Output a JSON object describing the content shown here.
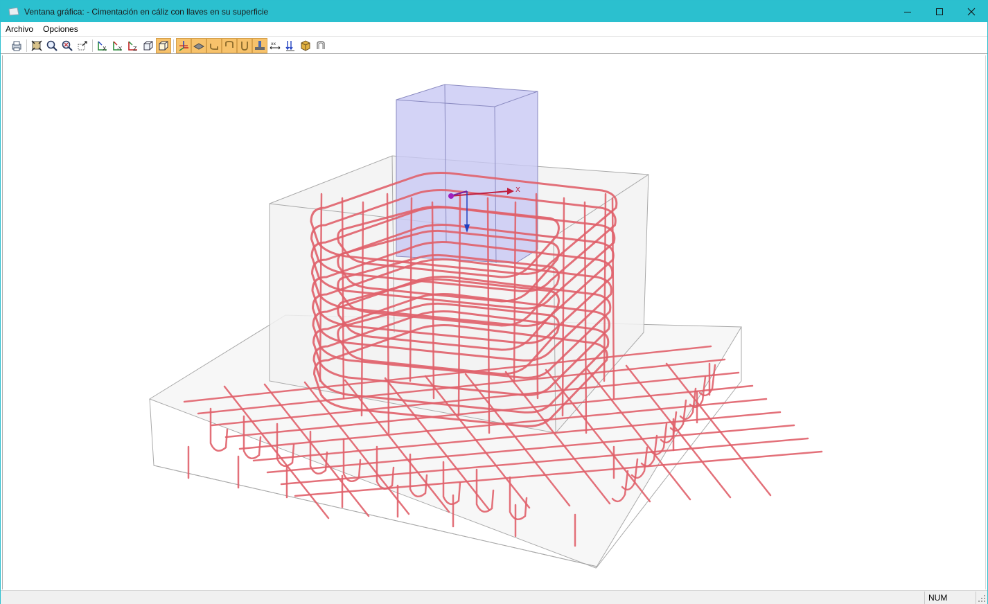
{
  "window": {
    "title": "Ventana gráfica: - Cimentación en cáliz con llaves en su superficie",
    "title_bar_color": "#2bc0cf"
  },
  "menu": {
    "items": [
      {
        "label": "Archivo"
      },
      {
        "label": "Opciones"
      }
    ]
  },
  "toolbar": {
    "buttons": [
      {
        "icon": "print-icon",
        "active": false
      },
      {
        "icon": "zoom-extents-icon",
        "active": false
      },
      {
        "icon": "zoom-icon",
        "active": false
      },
      {
        "icon": "zoom-window-icon",
        "active": false
      },
      {
        "icon": "pan-icon",
        "active": false
      },
      {
        "icon": "view-x-icon",
        "active": false
      },
      {
        "icon": "view-y-icon",
        "active": false
      },
      {
        "icon": "view-z-icon",
        "active": false
      },
      {
        "icon": "view-3d-wire-icon",
        "active": false
      },
      {
        "icon": "view-3d-solid-icon",
        "active": true
      },
      {
        "icon": "axes-icon",
        "active": true
      },
      {
        "icon": "slab-icon",
        "active": true
      },
      {
        "icon": "hook-left-icon",
        "active": true
      },
      {
        "icon": "hook-right-icon",
        "active": true
      },
      {
        "icon": "u-bar-icon",
        "active": true
      },
      {
        "icon": "foundation-icon",
        "active": true
      },
      {
        "icon": "dimension-icon",
        "active": false
      },
      {
        "icon": "loads-icon",
        "active": false
      },
      {
        "icon": "materials-icon",
        "active": false
      },
      {
        "icon": "stirrup-icon",
        "active": false
      }
    ]
  },
  "viewport": {
    "axis_label": "X",
    "rebar_color": "#e0606a",
    "column_color": "#c8c8f4"
  },
  "statusbar": {
    "num_indicator": "NUM"
  }
}
